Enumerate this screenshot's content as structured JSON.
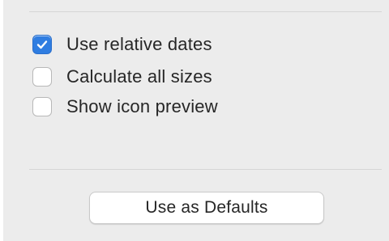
{
  "options": [
    {
      "label": "Use relative dates",
      "checked": true
    },
    {
      "label": "Calculate all sizes",
      "checked": false
    },
    {
      "label": "Show icon preview",
      "checked": false
    }
  ],
  "defaults_button": {
    "label": "Use as Defaults"
  },
  "colors": {
    "panel_background": "#ececec",
    "checkbox_accent": "#2f7de1",
    "text": "#262626"
  }
}
